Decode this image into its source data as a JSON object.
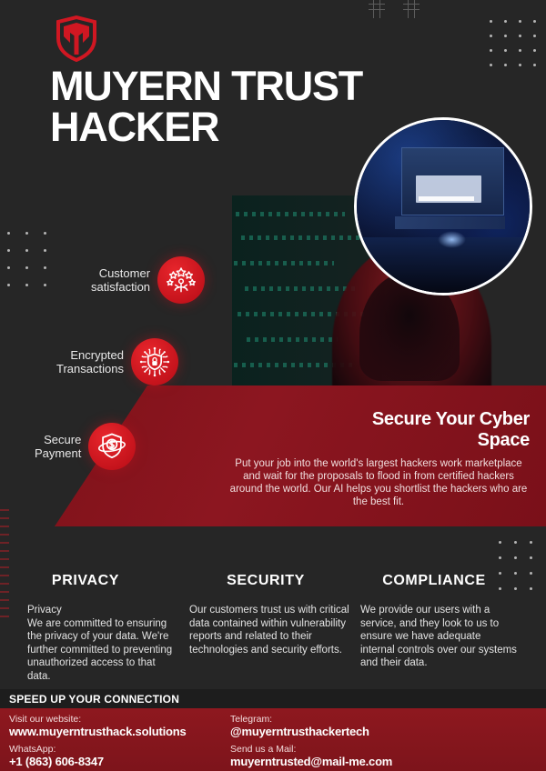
{
  "brand": {
    "logo_icon": "shield-m-logo",
    "title_line1": "MUYERN TRUST",
    "title_line2": "HACKER",
    "accent_red": "#c3121b",
    "banner_red": "#8c1620",
    "background": "#262626"
  },
  "hero": {
    "photo_alt": "hacker-workstation-photo"
  },
  "features": [
    {
      "label": "Customer\nsatisfaction",
      "icon": "customer-satisfaction-stars-icon"
    },
    {
      "label": "Encrypted\nTransactions",
      "icon": "encrypted-shield-lock-icon"
    },
    {
      "label": "Secure\nPayment",
      "icon": "secure-payment-shield-dollar-icon"
    }
  ],
  "banner": {
    "heading_line1": "Secure Your Cyber",
    "heading_line2": "Space",
    "body": "Put your job into the world's largest hackers work marketplace and wait for the proposals to flood in from certified hackers around the world. Our AI helps you shortlist the hackers who are the best fit."
  },
  "columns": [
    {
      "title": "PRIVACY",
      "body": "Privacy\nWe are committed to ensuring the privacy of your data. We're further committed to preventing unauthorized access to that data."
    },
    {
      "title": "SECURITY",
      "body": "Our customers trust us with critical data contained within vulnerability reports and related to their technologies and security efforts."
    },
    {
      "title": "COMPLIANCE",
      "body": "We provide our users with a service, and they look to us to ensure we have adequate internal controls over our systems and their data."
    }
  ],
  "footer": {
    "speed_bar": "SPEED UP YOUR CONNECTION",
    "website_caption": "Visit our website:",
    "website_value": "www.muyerntrusthack.solutions",
    "telegram_caption": "Telegram:",
    "telegram_value": "@muyerntrusthackertech",
    "whatsapp_caption": "WhatsApp:",
    "whatsapp_value": "+1 (863) 606-8347",
    "mail_caption": "Send us a Mail:",
    "mail_value": "muyerntrusted@mail-me.com"
  }
}
